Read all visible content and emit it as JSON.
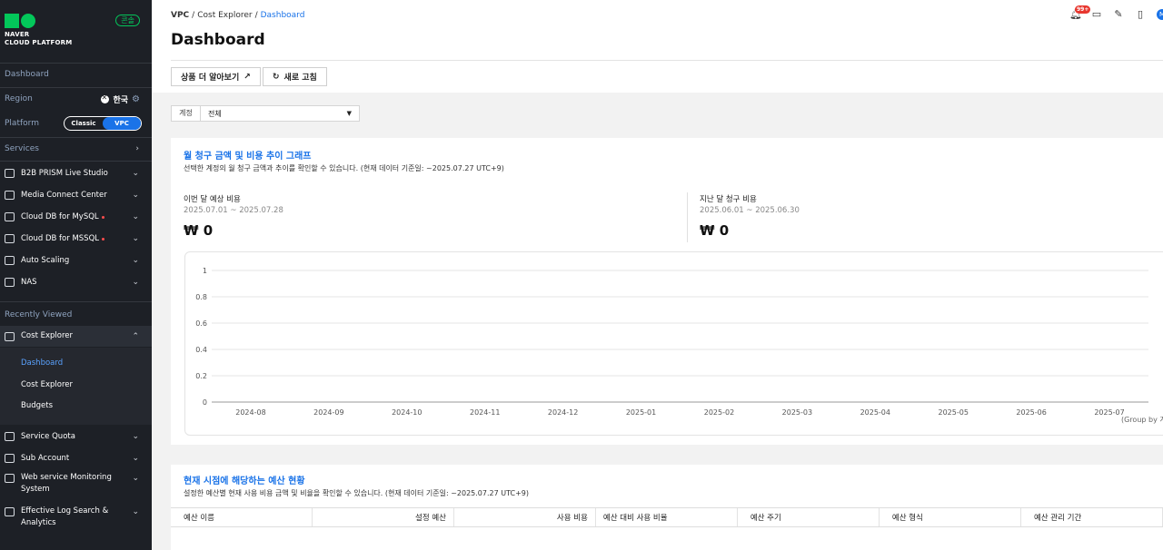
{
  "sidebar": {
    "logo_line1": "NAVER",
    "logo_line2": "CLOUD PLATFORM",
    "badge": "콘솔",
    "dashboard": "Dashboard",
    "region_label": "Region",
    "region_value": "한국",
    "platform_label": "Platform",
    "platform_options": [
      "Classic",
      "VPC"
    ],
    "services_label": "Services",
    "services": [
      {
        "label": "B2B PRISM Live Studio",
        "dot": false
      },
      {
        "label": "Media Connect Center",
        "dot": false
      },
      {
        "label": "Cloud DB for MySQL",
        "dot": true
      },
      {
        "label": "Cloud DB for MSSQL",
        "dot": true
      },
      {
        "label": "Auto Scaling",
        "dot": false
      },
      {
        "label": "NAS",
        "dot": false
      }
    ],
    "recently_viewed_label": "Recently Viewed",
    "recent_active": "Cost Explorer",
    "recent_sub": [
      "Dashboard",
      "Cost Explorer",
      "Budgets"
    ],
    "recent_more": [
      {
        "line1": "Service Quota",
        "line2": ""
      },
      {
        "line1": "Sub Account",
        "line2": ""
      },
      {
        "line1": "Web service Monitoring",
        "line2": "System"
      },
      {
        "line1": "Effective Log Search &",
        "line2": "Analytics"
      }
    ]
  },
  "header": {
    "breadcrumb": [
      "VPC",
      "Cost Explorer",
      "Dashboard"
    ],
    "title": "Dashboard",
    "notif_count": "99+",
    "avatar": "M",
    "btn_more": "상품 더 알아보기",
    "btn_refresh": "새로 고침"
  },
  "filter": {
    "label": "계정",
    "value": "전체"
  },
  "trend_card": {
    "title": "월 청구 금액 및 비용 추이 그래프",
    "desc": "선택한 계정의 월 청구 금액과 추이를 확인할 수 있습니다. (현재 데이터 기준일: ~2025.07.27 UTC+9)",
    "this_month_label": "이번 달 예상 비용",
    "this_month_period": "2025.07.01 ~ 2025.07.28",
    "this_month_value": "₩ 0",
    "last_month_label": "지난 달 청구 비용",
    "last_month_period": "2025.06.01 ~ 2025.06.30",
    "last_month_value": "₩ 0",
    "group_note": "(Group by 계"
  },
  "chart_data": {
    "type": "bar",
    "categories": [
      "2024-08",
      "2024-09",
      "2024-10",
      "2024-11",
      "2024-12",
      "2025-01",
      "2025-02",
      "2025-03",
      "2025-04",
      "2025-05",
      "2025-06",
      "2025-07"
    ],
    "values": [
      0,
      0,
      0,
      0,
      0,
      0,
      0,
      0,
      0,
      0,
      0,
      0
    ],
    "yticks": [
      "0",
      "0.2",
      "0.4",
      "0.6",
      "0.8",
      "1"
    ],
    "ylim": [
      0,
      1
    ],
    "grid": true
  },
  "budget_card": {
    "title": "현재 시점에 해당하는 예산 현황",
    "desc": "설정한 예산별 현재 사용 비용 금액 및 비율을 확인할 수 있습니다. (현재 데이터 기준일: ~2025.07.27 UTC+9)",
    "columns": [
      "예산 이름",
      "설정 예산",
      "사용 비용",
      "예산 대비 사용 비율",
      "예산 주기",
      "예산 형식",
      "예산 관리 기간"
    ]
  },
  "colors": {
    "accent": "#1a73e8",
    "brand": "#03c75a",
    "sidebar_bg": "#1d2026"
  }
}
